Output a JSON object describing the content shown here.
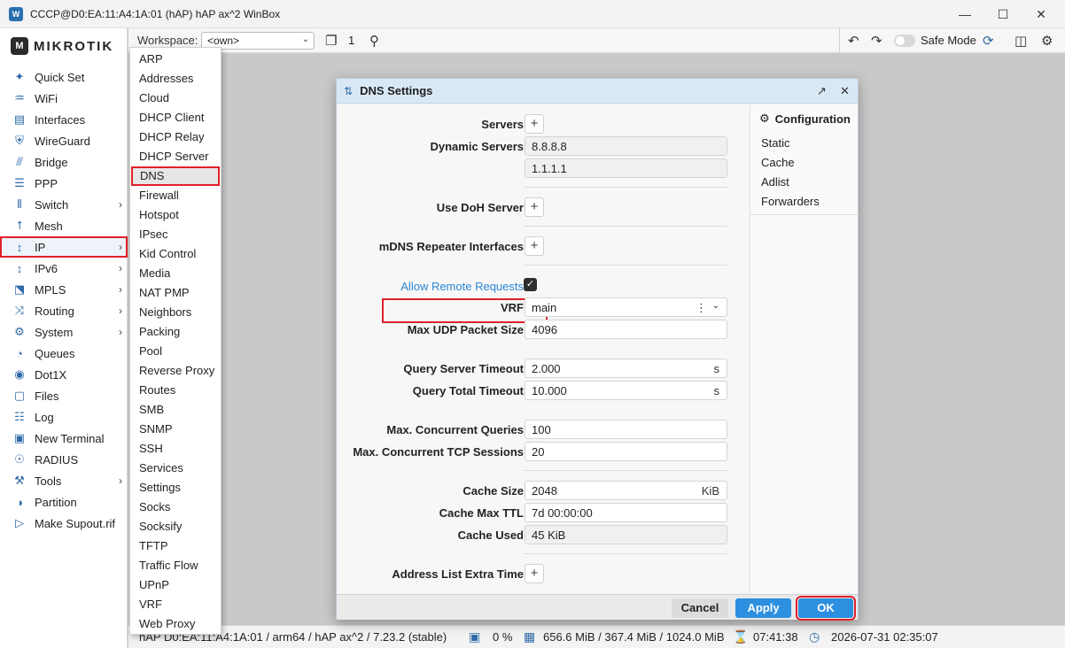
{
  "window": {
    "title": "CCCP@D0:EA:11:A4:1A:01 (hAP) hAP ax^2 WinBox",
    "app_icon": "W"
  },
  "logo": {
    "text": "MIKROTIK"
  },
  "sidebar": {
    "items": [
      {
        "label": "Quick Set",
        "icon": "wand-icon"
      },
      {
        "label": "WiFi",
        "icon": "wifi-icon"
      },
      {
        "label": "Interfaces",
        "icon": "interfaces-icon"
      },
      {
        "label": "WireGuard",
        "icon": "wireguard-icon"
      },
      {
        "label": "Bridge",
        "icon": "bridge-icon"
      },
      {
        "label": "PPP",
        "icon": "ppp-icon"
      },
      {
        "label": "Switch",
        "icon": "switch-icon",
        "submenu": true
      },
      {
        "label": "Mesh",
        "icon": "mesh-icon"
      },
      {
        "label": "IP",
        "icon": "ipv4-icon",
        "submenu": true,
        "active": true
      },
      {
        "label": "IPv6",
        "icon": "ipv6-icon",
        "submenu": true
      },
      {
        "label": "MPLS",
        "icon": "mpls-icon",
        "submenu": true
      },
      {
        "label": "Routing",
        "icon": "routing-icon",
        "submenu": true
      },
      {
        "label": "System",
        "icon": "system-gear-icon",
        "submenu": true
      },
      {
        "label": "Queues",
        "icon": "queues-icon"
      },
      {
        "label": "Dot1X",
        "icon": "dot1x-icon"
      },
      {
        "label": "Files",
        "icon": "files-icon"
      },
      {
        "label": "Log",
        "icon": "log-icon"
      },
      {
        "label": "New Terminal",
        "icon": "terminal-icon"
      },
      {
        "label": "RADIUS",
        "icon": "radius-icon"
      },
      {
        "label": "Tools",
        "icon": "tools-icon",
        "submenu": true
      },
      {
        "label": "Partition",
        "icon": "partition-icon"
      },
      {
        "label": "Make Supout.rif",
        "icon": "supout-icon"
      }
    ]
  },
  "toolbar": {
    "workspace_label": "Workspace:",
    "workspace_value": "<own>",
    "window_count": "1",
    "safe_mode_label": "Safe Mode",
    "safe_mode_on": false
  },
  "ip_menu": {
    "items": [
      "ARP",
      "Addresses",
      "Cloud",
      "DHCP Client",
      "DHCP Relay",
      "DHCP Server",
      "DNS",
      "Firewall",
      "Hotspot",
      "IPsec",
      "Kid Control",
      "Media",
      "NAT PMP",
      "Neighbors",
      "Packing",
      "Pool",
      "Reverse Proxy",
      "Routes",
      "SMB",
      "SNMP",
      "SSH",
      "Services",
      "Settings",
      "Socks",
      "Socksify",
      "TFTP",
      "Traffic Flow",
      "UPnP",
      "VRF",
      "Web Proxy"
    ],
    "selected": "DNS"
  },
  "dialog": {
    "title": "DNS Settings",
    "fields": {
      "servers_label": "Servers",
      "dynamic_servers_label": "Dynamic Servers",
      "dynamic_server_1": "8.8.8.8",
      "dynamic_server_2": "1.1.1.1",
      "use_doh_label": "Use DoH Server",
      "mdns_label": "mDNS Repeater Interfaces",
      "allow_remote_label": "Allow Remote Requests",
      "allow_remote_checked": true,
      "vrf_label": "VRF",
      "vrf_value": "main",
      "max_udp_label": "Max UDP Packet Size",
      "max_udp_value": "4096",
      "query_server_timeout_label": "Query Server Timeout",
      "query_server_timeout_value": "2.000",
      "query_server_timeout_unit": "s",
      "query_total_timeout_label": "Query Total Timeout",
      "query_total_timeout_value": "10.000",
      "query_total_timeout_unit": "s",
      "max_concurrent_queries_label": "Max. Concurrent Queries",
      "max_concurrent_queries_value": "100",
      "max_concurrent_tcp_label": "Max. Concurrent TCP Sessions",
      "max_concurrent_tcp_value": "20",
      "cache_size_label": "Cache Size",
      "cache_size_value": "2048",
      "cache_size_unit": "KiB",
      "cache_max_ttl_label": "Cache Max TTL",
      "cache_max_ttl_value": "7d 00:00:00",
      "cache_used_label": "Cache Used",
      "cache_used_value": "45 KiB",
      "address_list_extra_label": "Address List Extra Time"
    },
    "side": {
      "heading": "Configuration",
      "items": [
        "Static",
        "Cache",
        "Adlist",
        "Forwarders"
      ]
    },
    "buttons": {
      "cancel": "Cancel",
      "apply": "Apply",
      "ok": "OK"
    }
  },
  "statusbar": {
    "device": "hAP  D0:EA:11:A4:1A:01 / arm64 / hAP ax^2 / 7.23.2 (stable)",
    "cpu": "0 %",
    "memory": "656.6 MiB / 367.4 MiB / 1024.0 MiB",
    "uptime": "07:41:38",
    "datetime": "2026-07-31 02:35:07"
  },
  "colors": {
    "accent_blue": "#2d8fe0",
    "highlight_red": "#e0202a",
    "link_blue": "#2b86d6",
    "dialog_header": "#d9e8f5"
  }
}
